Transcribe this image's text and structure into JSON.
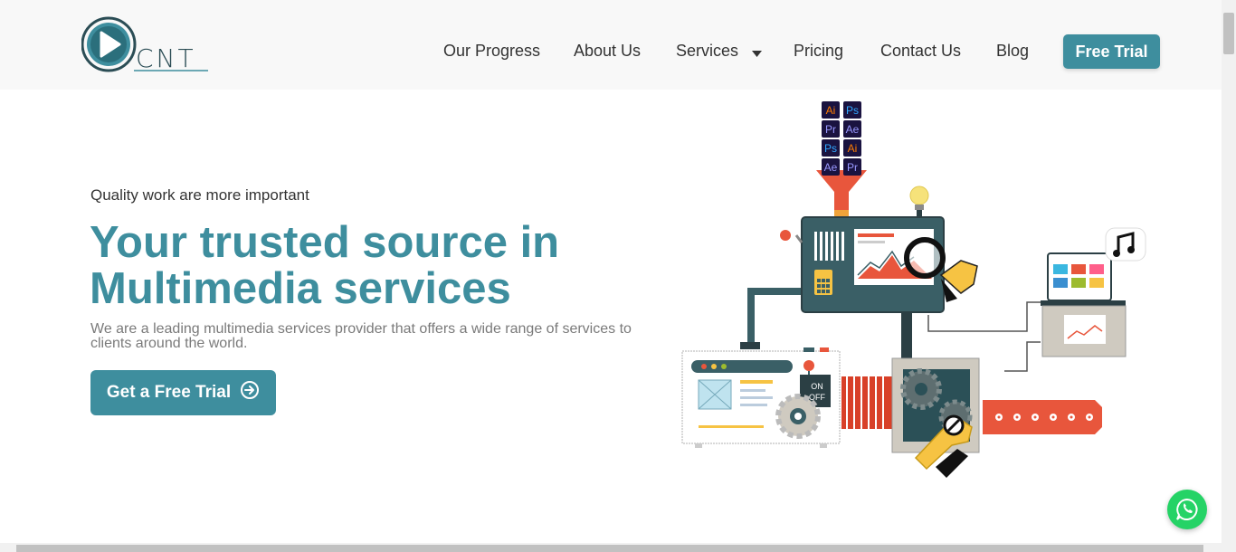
{
  "brand": {
    "logo_text": "CNT",
    "accent_color": "#3e8e9e"
  },
  "nav": {
    "items": [
      "Our Progress",
      "About Us",
      "Services",
      "Pricing",
      "Contact Us",
      "Blog"
    ],
    "cta_label": "Free Trial"
  },
  "hero": {
    "subtitle": "Quality work are more important",
    "title_line1": "Your trusted source in",
    "title_line2": "Multimedia services",
    "description": "We are a leading multimedia services provider that offers a wide range of services to clients around the world.",
    "button_label": "Get a Free Trial"
  },
  "illustration": {
    "app_badges": [
      {
        "label": "Ai",
        "color": "#ff7c00"
      },
      {
        "label": "Ps",
        "color": "#31a8ff"
      },
      {
        "label": "Pr",
        "color": "#9999ff"
      },
      {
        "label": "Ae",
        "color": "#9999ff"
      },
      {
        "label": "Ps",
        "color": "#31a8ff"
      },
      {
        "label": "Ai",
        "color": "#ff7c00"
      },
      {
        "label": "Ae",
        "color": "#9999ff"
      },
      {
        "label": "Pr",
        "color": "#9999ff"
      }
    ],
    "switch_on": "ON",
    "switch_off": "OFF"
  },
  "icons": {
    "logo": "play-icon",
    "services_caret": "caret-down-icon",
    "hero_button": "arrow-circle-right-icon",
    "chat": "whatsapp-icon",
    "music": "music-note-icon"
  }
}
